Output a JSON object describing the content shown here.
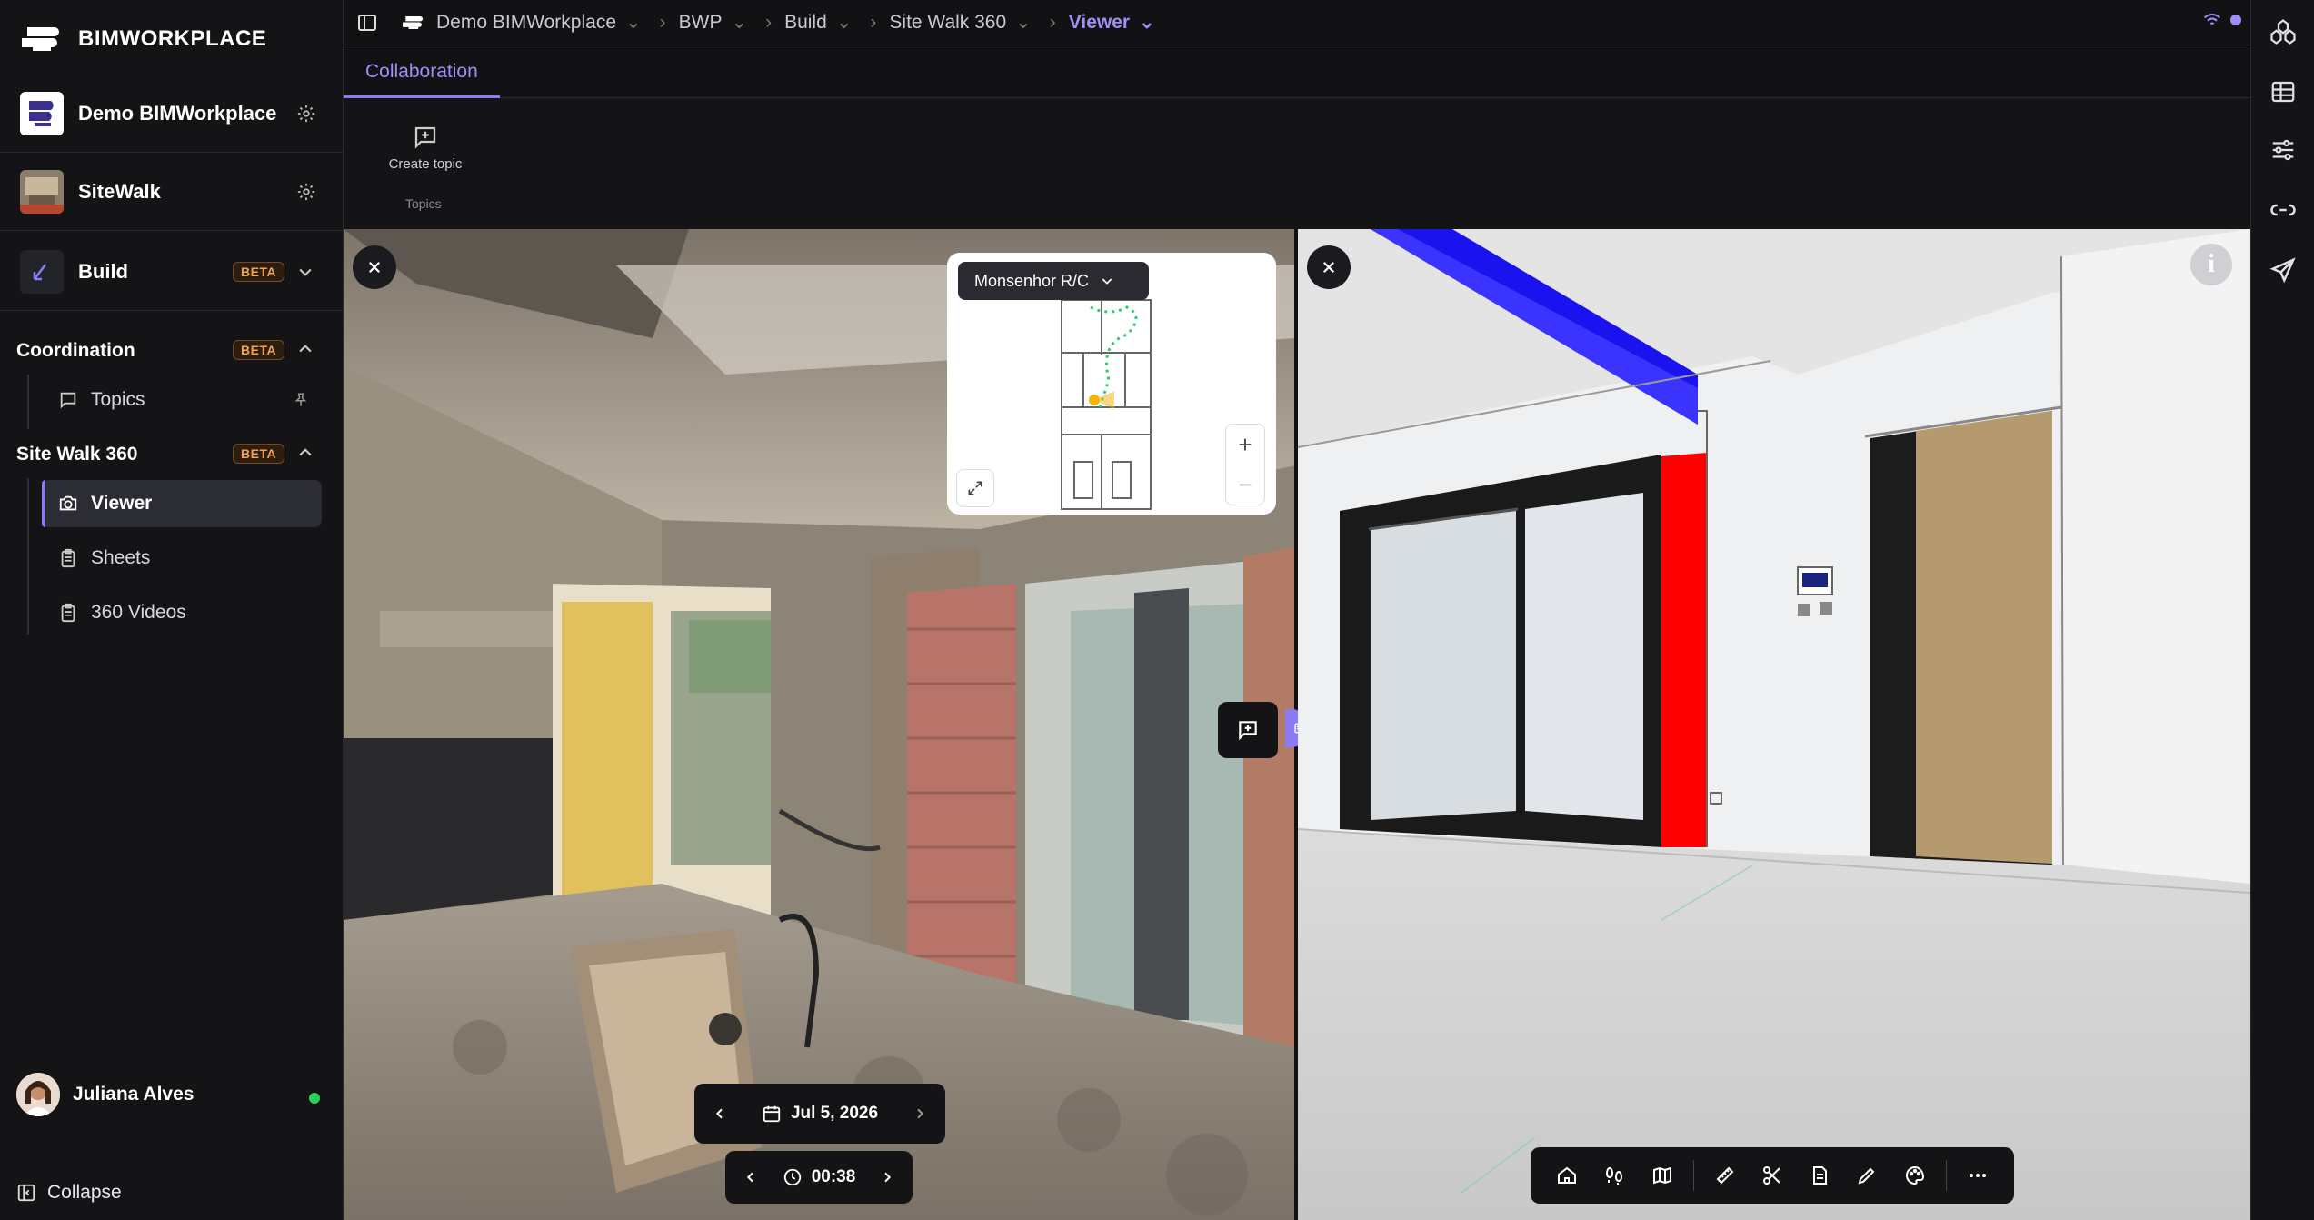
{
  "app": {
    "logo_text": "BIMWORKPLACE"
  },
  "projects": [
    {
      "name": "Demo BIMWorkplace"
    },
    {
      "name": "SiteWalk"
    },
    {
      "name": "Build",
      "badge": "BETA"
    }
  ],
  "sections": {
    "coordination": {
      "title": "Coordination",
      "badge": "BETA",
      "items": [
        {
          "label": "Topics"
        }
      ]
    },
    "sitewalk": {
      "title": "Site Walk 360",
      "badge": "BETA",
      "items": [
        {
          "label": "Viewer"
        },
        {
          "label": "Sheets"
        },
        {
          "label": "360 Videos"
        }
      ]
    }
  },
  "user": {
    "name": "Juliana Alves"
  },
  "collapse_label": "Collapse",
  "breadcrumb": [
    "Demo BIMWorkplace",
    "BWP",
    "Build",
    "Site Walk 360",
    "Viewer"
  ],
  "tabs": [
    {
      "label": "Collaboration"
    }
  ],
  "toolbar": {
    "create_topic": "Create topic",
    "group": "Topics"
  },
  "viewer": {
    "floor": "Monsenhor R/C",
    "date": "Jul 5, 2026",
    "time": "00:38"
  },
  "colors": {
    "accent": "#8b7cf6",
    "online": "#2fd05a",
    "badge": "#f3a24d"
  }
}
